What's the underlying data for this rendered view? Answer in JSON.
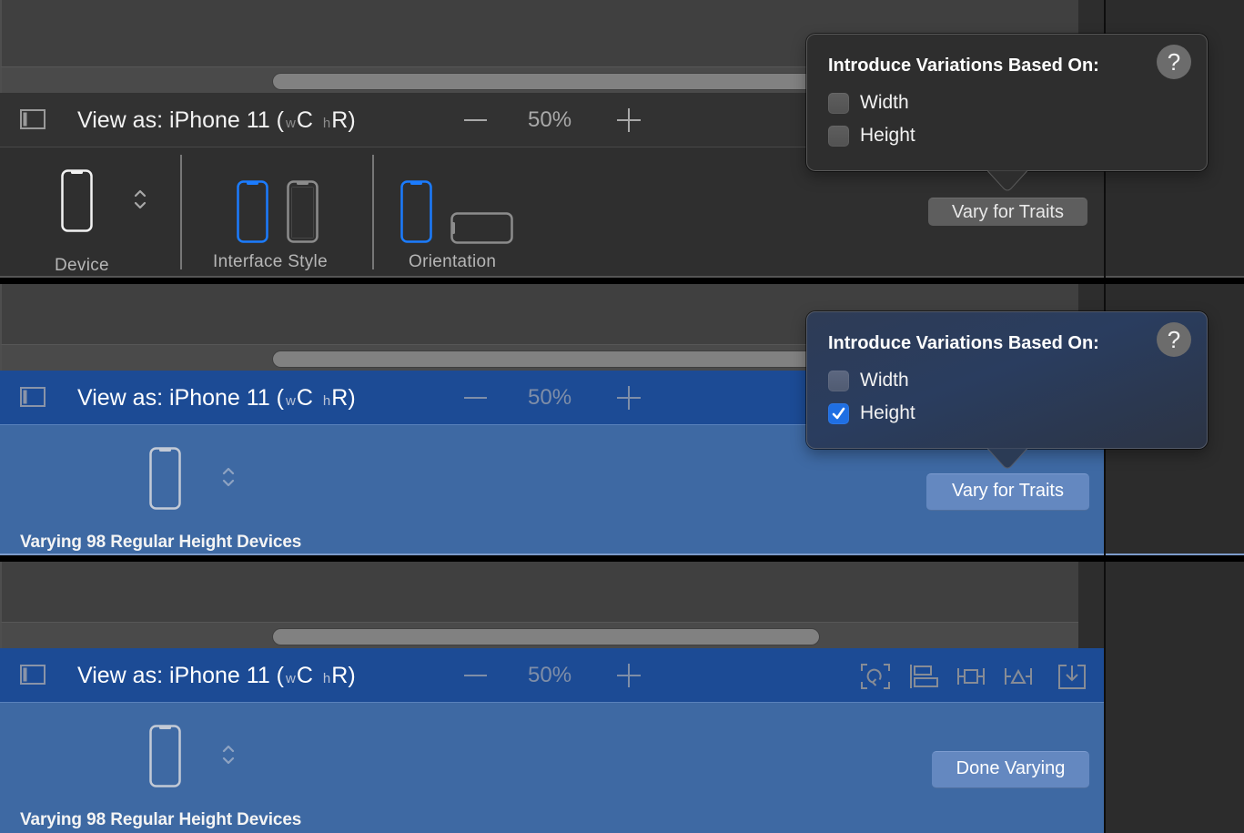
{
  "colors": {
    "accent_blue": "#1b7cff",
    "varying_header": "#1c4b95",
    "varying_body": "#3e69a3",
    "checkbox_checked": "#1f6fe3"
  },
  "panels": [
    {
      "state": "trait-picker",
      "device_bar": {
        "title": "View as: iPhone 11 (",
        "width_class_label": "w",
        "width_class_value": "C",
        "height_class_label": "h",
        "height_class_value": "R",
        "title_close": ")",
        "zoom_level": "50%"
      },
      "traits": {
        "device_label": "Device",
        "interface_style_label": "Interface Style",
        "interface_styles": [
          {
            "name": "Light",
            "selected": true
          },
          {
            "name": "Dark",
            "selected": false
          }
        ],
        "orientation_label": "Orientation",
        "orientations": [
          {
            "name": "Portrait",
            "selected": true
          },
          {
            "name": "Landscape",
            "selected": false
          }
        ]
      },
      "vary_button": "Vary for Traits",
      "popover": {
        "title": "Introduce Variations Based On:",
        "help_label": "?",
        "options": [
          {
            "label": "Width",
            "checked": false
          },
          {
            "label": "Height",
            "checked": false
          }
        ]
      }
    },
    {
      "state": "height-selected",
      "device_bar": {
        "title": "View as: iPhone 11 (",
        "width_class_label": "w",
        "width_class_value": "C",
        "height_class_label": "h",
        "height_class_value": "R",
        "title_close": ")",
        "zoom_level": "50%"
      },
      "status": "Varying 98 Regular Height Devices",
      "vary_button": "Vary for Traits",
      "popover": {
        "title": "Introduce Variations Based On:",
        "help_label": "?",
        "options": [
          {
            "label": "Width",
            "checked": false
          },
          {
            "label": "Height",
            "checked": true
          }
        ]
      }
    },
    {
      "state": "varying",
      "device_bar": {
        "title": "View as: iPhone 11 (",
        "width_class_label": "w",
        "width_class_value": "C",
        "height_class_label": "h",
        "height_class_value": "R",
        "title_close": ")",
        "zoom_level": "50%"
      },
      "toolbar_icons": [
        "update-frames-icon",
        "align-icon",
        "add-new-constraints-icon",
        "resolve-auto-layout-issues-icon",
        "embed-in-icon"
      ],
      "status": "Varying 98 Regular Height Devices",
      "done_button": "Done Varying"
    }
  ]
}
